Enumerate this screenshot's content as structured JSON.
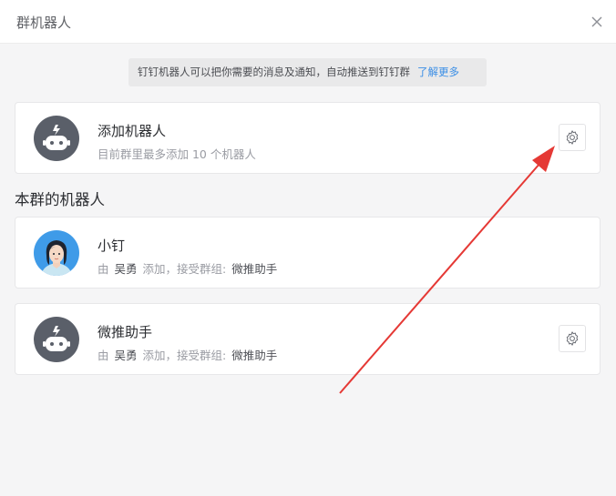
{
  "window": {
    "title": "群机器人"
  },
  "notice": {
    "text": "钉钉机器人可以把你需要的消息及通知，自动推送到钉钉群",
    "link": "了解更多"
  },
  "add_robot": {
    "title": "添加机器人",
    "subtitle": "目前群里最多添加 10 个机器人"
  },
  "section": {
    "title": "本群的机器人"
  },
  "robots": [
    {
      "name": "小钉",
      "by_prefix": "由",
      "added_by": "吴勇",
      "added_text": "添加，接受群组:",
      "group": "微推助手",
      "avatar": "person-avatar",
      "has_settings": false
    },
    {
      "name": "微推助手",
      "by_prefix": "由",
      "added_by": "吴勇",
      "added_text": "添加，接受群组:",
      "group": "微推助手",
      "avatar": "robot-avatar",
      "has_settings": true
    }
  ],
  "colors": {
    "accent_link": "#3a8ee6",
    "annotation_arrow": "#e53935",
    "robot_icon_bg": "#5a5f69",
    "person_avatar_bg": "#3f9be8"
  },
  "icons": {
    "close": "close-icon",
    "settings": "gear-icon",
    "robot": "robot-icon"
  }
}
